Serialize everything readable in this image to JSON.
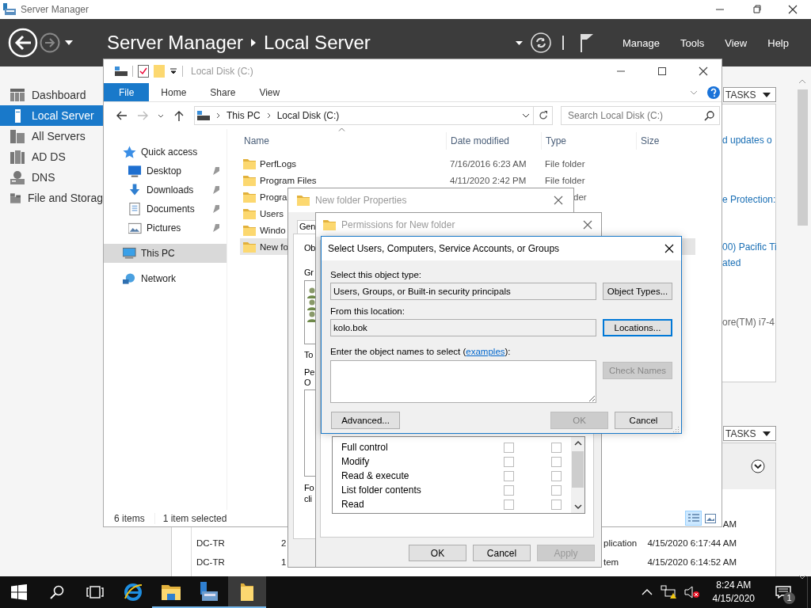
{
  "server_manager": {
    "window_title": "Server Manager",
    "breadcrumb": [
      "Server Manager",
      "Local Server"
    ],
    "menu": [
      "Manage",
      "Tools",
      "View",
      "Help"
    ],
    "sidebar": [
      {
        "label": "Dashboard",
        "selected": false
      },
      {
        "label": "Local Server",
        "selected": true
      },
      {
        "label": "All Servers",
        "selected": false
      },
      {
        "label": "AD DS",
        "selected": false
      },
      {
        "label": "DNS",
        "selected": false
      },
      {
        "label": "File and Storag",
        "selected": false
      }
    ],
    "properties_tile": {
      "tasks": "TASKS",
      "entries": [
        {
          "kind": "link",
          "text": "d updates o"
        },
        {
          "kind": "link",
          "text": "e Protection:"
        },
        {
          "kind": "link",
          "text": "00) Pacific Ti"
        },
        {
          "kind": "link",
          "text": "ated"
        },
        {
          "kind": "text",
          "text": "ore(TM) i7-4"
        }
      ]
    },
    "events_tile": {
      "tasks": "TASKS",
      "rows": [
        {
          "time": "AM"
        },
        {
          "server": "DC-TR",
          "column_2": "2",
          "column_3": "plication",
          "time": "4/15/2020 6:17:44 AM"
        },
        {
          "server": "DC-TR",
          "column_2": "1",
          "column_3": "tem",
          "time": "4/15/2020 6:14:52 AM"
        }
      ]
    }
  },
  "explorer": {
    "title": "Local Disk (C:)",
    "ribbon_tabs": [
      {
        "label": "File",
        "selected": true
      },
      {
        "label": "Home",
        "selected": false
      },
      {
        "label": "Share",
        "selected": false
      },
      {
        "label": "View",
        "selected": false
      }
    ],
    "address": [
      "This PC",
      "Local Disk (C:)"
    ],
    "search_placeholder": "Search Local Disk (C:)",
    "navigation": [
      {
        "label": "Quick access",
        "selected": false,
        "children": [
          {
            "label": "Desktop",
            "pinned": true,
            "selected": false
          },
          {
            "label": "Downloads",
            "pinned": true,
            "selected": false
          },
          {
            "label": "Documents",
            "pinned": true,
            "selected": false
          },
          {
            "label": "Pictures",
            "pinned": true,
            "selected": false
          }
        ]
      },
      {
        "label": "This PC",
        "selected": true
      },
      {
        "label": "Network",
        "selected": false
      }
    ],
    "columns": [
      "Name",
      "Date modified",
      "Type",
      "Size"
    ],
    "files": [
      {
        "name": "PerfLogs",
        "date": "7/16/2016 6:23 AM",
        "type": "File folder",
        "selected": false
      },
      {
        "name": "Program Files",
        "date": "4/11/2020 2:42 PM",
        "type": "File folder",
        "selected": false
      },
      {
        "name": "Progra",
        "type": "der",
        "type_cut_left": true,
        "selected": false
      },
      {
        "name": "Users",
        "selected": false
      },
      {
        "name": "Windo",
        "selected": false
      },
      {
        "name": "New fo",
        "selected": true
      }
    ],
    "status": [
      "6 items",
      "1 item selected"
    ]
  },
  "properties_window": {
    "title": "New folder Properties",
    "tab": "Gen",
    "object_label": "Ob",
    "group_label": "Gr",
    "edit_label": "To",
    "permissions_label": [
      "Pe",
      "O"
    ],
    "footer_label": [
      "Fo",
      "cli"
    ]
  },
  "permissions_window": {
    "title": "Permissions for New folder",
    "permissions": [
      {
        "name": "Full control",
        "allow": false,
        "deny": false
      },
      {
        "name": "Modify",
        "allow": false,
        "deny": false
      },
      {
        "name": "Read & execute",
        "allow": false,
        "deny": false
      },
      {
        "name": "List folder contents",
        "allow": false,
        "deny": false
      },
      {
        "name": "Read",
        "allow": false,
        "deny": false
      }
    ],
    "buttons": [
      {
        "label": "OK",
        "disabled": false
      },
      {
        "label": "Cancel",
        "disabled": false
      },
      {
        "label": "Apply",
        "disabled": true
      }
    ]
  },
  "select_dialog": {
    "title": "Select Users, Computers, Service Accounts, or Groups",
    "object_type": {
      "label": "Select this object type:",
      "value": "Users, Groups, or Built-in security principals",
      "button": "Object Types..."
    },
    "location": {
      "label": "From this location:",
      "value": "kolo.bok",
      "button": "Locations...",
      "focused": true
    },
    "names": {
      "label_before": "Enter the object names to select (",
      "link": "examples",
      "label_after": "):",
      "button": "Check Names",
      "button_disabled": true
    },
    "advanced": "Advanced...",
    "buttons": [
      {
        "label": "OK",
        "disabled": true
      },
      {
        "label": "Cancel",
        "disabled": false
      }
    ]
  },
  "taskbar": {
    "apps": [
      {
        "kind": "start",
        "running": false,
        "active": false
      },
      {
        "kind": "search",
        "running": false,
        "active": false
      },
      {
        "kind": "taskview",
        "running": false,
        "active": false
      },
      {
        "kind": "browser",
        "running": false,
        "active": false
      },
      {
        "kind": "explorer",
        "running": true,
        "active": false
      },
      {
        "kind": "server_manager",
        "running": true,
        "active": false
      },
      {
        "kind": "folder",
        "running": true,
        "active": true
      }
    ],
    "time": "8:24 AM",
    "date": "4/15/2020",
    "notifications": "1"
  }
}
